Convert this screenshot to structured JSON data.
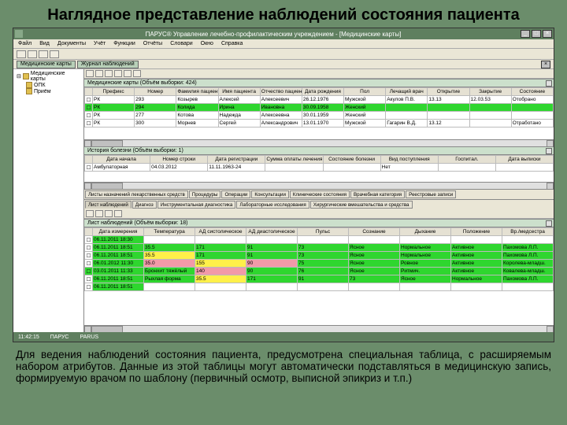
{
  "slide_title": "Наглядное представление наблюдений состояния пациента",
  "caption": "Для ведения наблюдений состояния пациента, предусмотрена специальная таблица, с расширяемым набором атрибутов. Данные из этой таблицы могут автоматически подставляться в медицинскую запись, формируемую врачом по шаблону (первичный осмотр, выписной эпикриз и т.п.)",
  "window": {
    "title": "ПАРУС® Управление лечебно-профилактическим учреждением - [Медицинские карты]"
  },
  "menu": [
    "Файл",
    "Вид",
    "Документы",
    "Учёт",
    "Функции",
    "Отчёты",
    "Словари",
    "Окно",
    "Справка"
  ],
  "tabs_top": [
    "Медицинские карты",
    "Журнал наблюдений"
  ],
  "tree": {
    "root": "Медицинские карты",
    "children": [
      "ОПК",
      "Приём"
    ]
  },
  "patients": {
    "header": "Медицинские карты (Объём выборки: 424)",
    "cols": [
      "",
      "Префикс",
      "Номер",
      "Фамилия пациента",
      "Имя пациента",
      "Отчество пациента",
      "Дата рождения",
      "Пол",
      "Лечащий врач",
      "Открытие",
      "Закрытие",
      "Состояние"
    ],
    "rows": [
      [
        "",
        "РК",
        "293",
        "Козырев",
        "Алексей",
        "Алексеевич",
        "26.12.1976",
        "Мужской",
        "Акулов П.В.",
        "13.13",
        "12.03.53",
        "Отобрано"
      ],
      [
        "sel",
        "РК",
        "294",
        "Колида",
        "Ирина",
        "Ивановна",
        "30.09.1958",
        "Женский",
        "",
        "",
        "",
        ""
      ],
      [
        "",
        "РК",
        "277",
        "Котова",
        "Надежда",
        "Алексеевна",
        "30.01.1959",
        "Женский",
        "",
        "",
        "",
        ""
      ],
      [
        "",
        "РК",
        "300",
        "Морнев",
        "Сергей",
        "Александрович",
        "13.01.1970",
        "Мужской",
        "Гагарин В.Д.",
        "13.12",
        "",
        "Отработано"
      ]
    ]
  },
  "history": {
    "header": "История болезни (Объём выборки: 1)",
    "cols": [
      "",
      "Дата начала",
      "Номер строки",
      "Дата регистрации",
      "Сумма оплаты лечения",
      "Состояние болезни",
      "Вид поступления",
      "Госпитал.",
      "Дата выписки"
    ],
    "rows": [
      [
        "",
        "Амбулаторная",
        "04.03.2012",
        "11.11.1963-24",
        "",
        "",
        "Нет",
        "",
        ""
      ]
    ]
  },
  "detail_tabs_row1": [
    "Листы назначений лекарственных средств",
    "Процедуры",
    "Операции",
    "Консультации",
    "Клинические состояния",
    "Врачебная категория",
    "Реестровые записи"
  ],
  "detail_tabs_row2": [
    "Лист наблюдений",
    "Диагноз",
    "Инструментальная диагностика",
    "Лабораторные исследования",
    "Хирургические вмешательства и средства"
  ],
  "obs": {
    "header": "Лист наблюдений (Объём выборки: 18)",
    "cols": [
      "",
      "Дата измерения",
      "Температура",
      "АД систолическое",
      "АД диастолическое",
      "Пульс",
      "Сознание",
      "Дыхание",
      "Положение",
      "Вр./медсестра"
    ],
    "rows": [
      [
        "",
        "06.11.2011 18:30",
        "",
        "",
        "",
        "",
        "",
        "",
        "",
        ""
      ],
      [
        "",
        "06.11.2011 18:51",
        "35.5",
        "171",
        "91",
        "73",
        "Ясное",
        "Нормальное",
        "Активное",
        "Пахомова Л.П."
      ],
      [
        "",
        "06.11.2011 18:51",
        "35.5",
        "171",
        "91",
        "73",
        "Ясное",
        "Нормальное",
        "Активное",
        "Пахомова Л.П."
      ],
      [
        "",
        "06.01.2012 11:30",
        "35.0",
        "155",
        "90",
        "75",
        "Ясное",
        "Ровное",
        "Активное",
        "Королева-младш."
      ],
      [
        "sel",
        "03.01.2011 11:33",
        "Бронхит тяжёлый",
        "140",
        "90",
        "76",
        "Ясное",
        "Ритмич.",
        "Активное",
        "Ковалева-младш."
      ],
      [
        "",
        "06.11.2011 18:51",
        "Рыхлая форма",
        "35.5",
        "171",
        "91",
        "73",
        "Ясное",
        "Нормальное",
        "Пахомова Л.П."
      ],
      [
        "",
        "06.11.2011 18:51",
        "",
        "",
        "",
        "",
        "",
        "",
        "",
        ""
      ]
    ],
    "cell_colors": [
      [
        "",
        "g",
        "",
        "",
        "",
        "",
        "",
        "",
        "",
        ""
      ],
      [
        "",
        "g",
        "g",
        "g",
        "g",
        "g",
        "g",
        "g",
        "g",
        "g"
      ],
      [
        "",
        "g",
        "y",
        "g",
        "g",
        "g",
        "g",
        "g",
        "g",
        "g"
      ],
      [
        "",
        "g",
        "p",
        "y",
        "p",
        "g",
        "g",
        "g",
        "g",
        "g"
      ],
      [
        "",
        "g",
        "g",
        "p",
        "g",
        "g",
        "g",
        "g",
        "g",
        "g"
      ],
      [
        "",
        "g",
        "g",
        "y",
        "g",
        "g",
        "g",
        "g",
        "g",
        "g"
      ],
      [
        "",
        "g",
        "",
        "",
        "",
        "",
        "",
        "",
        "",
        ""
      ]
    ]
  },
  "status": {
    "time": "11:42:15",
    "user": "ПАРУС",
    "db": "PARUS"
  }
}
